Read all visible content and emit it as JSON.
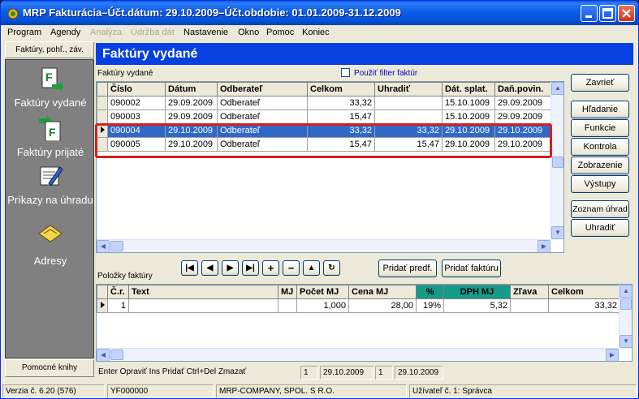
{
  "window": {
    "title": "MRP Fakturácia–Účt.dátum: 29.10.2009–Účt.obdobie: 01.01.2009-31.12.2009"
  },
  "menu": [
    "Program",
    "Agendy",
    "Analýza",
    "Údržba dát",
    "Nastavenie",
    "Okno",
    "Pomoc",
    "Koniec"
  ],
  "sidebar": {
    "header": "Faktúry, pohľ., záv.",
    "items": [
      "Faktúry vydané",
      "Faktúry prijaté",
      "Príkazy na úhradu",
      "Adresy"
    ],
    "footer": "Pomocné knihy"
  },
  "main": {
    "title": "Faktúry vydané",
    "grid_label": "Faktúry vydané",
    "filter_label": "Použiť filter faktúr"
  },
  "invoices": {
    "columns": [
      "Číslo",
      "Dátum",
      "Odberateľ",
      "Celkom",
      "Uhradiť",
      "Dát. splat.",
      "Daň.povin."
    ],
    "rows": [
      [
        "090002",
        "29.09.2009",
        "Odberateľ",
        "33,32",
        "",
        "15.10.1009",
        "29.09.2009"
      ],
      [
        "090003",
        "29.09.2009",
        "Odberateľ",
        "15,47",
        "",
        "15.10.2009",
        "29.09.2009"
      ],
      [
        "090004",
        "29.10.2009",
        "Odberateľ",
        "33,32",
        "33,32",
        "29.10.2009",
        "29.10.2009"
      ],
      [
        "090005",
        "29.10.2009",
        "Odberateľ",
        "15,47",
        "15,47",
        "29.10.2009",
        "29.10.2009"
      ]
    ],
    "selected_row": 2
  },
  "nav": {
    "add_predef": "Pridať predf.",
    "add_invoice": "Pridať faktúru"
  },
  "items": {
    "label": "Položky faktúry",
    "columns": [
      "Č.r.",
      "Text",
      "MJ",
      "Počet MJ",
      "Cena MJ",
      "%",
      "DPH MJ",
      "Zľava",
      "Celkom"
    ],
    "rows": [
      [
        "1",
        "",
        "",
        "1,000",
        "28,00",
        "19%",
        "5,32",
        "",
        "33,32"
      ]
    ]
  },
  "right_buttons": [
    "Zavrieť",
    "Hľadanie",
    "Funkcie",
    "Kontrola",
    "Zobrazenie",
    "Výstupy",
    "Zoznam úhrad",
    "Uhradiť"
  ],
  "hints": {
    "text": "Enter Opraviť  Ins Pridať  Ctrl+Del Zmazať",
    "f1": "1",
    "f2": "29.10.2009",
    "f3": "1",
    "f4": "29.10.2009"
  },
  "statusbar": {
    "version": "Verzia č. 6.20 (576)",
    "code": "YF000000",
    "company": "MRP-COMPANY, SPOL. S R.O.",
    "user": "Užívateľ č. 1: Správca"
  },
  "colors": {
    "title_blue": "#0640e0",
    "selection": "#3168c8",
    "highlight": "#d61f1f",
    "accent_green": "#159b8a"
  }
}
